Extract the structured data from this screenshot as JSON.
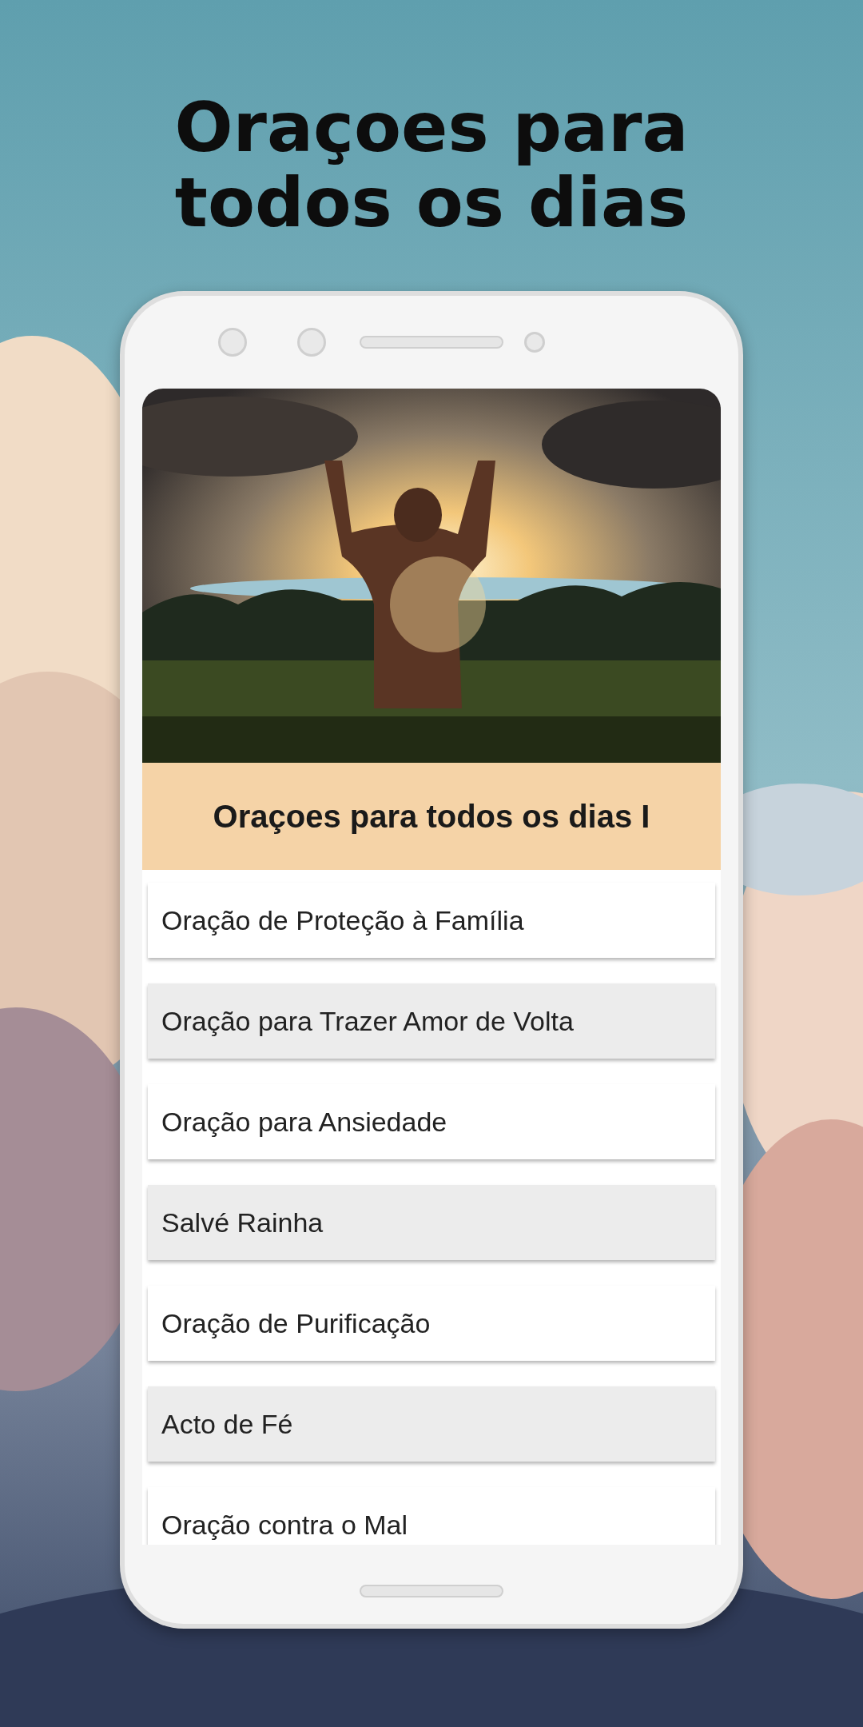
{
  "headline": "Oraçoes para todos os dias",
  "app": {
    "section_title": "Oraçoes para todos os dias I",
    "items": [
      {
        "label": "Oração de Proteção à Família"
      },
      {
        "label": "Oração para Trazer Amor de Volta"
      },
      {
        "label": "Oração para Ansiedade"
      },
      {
        "label": "Salvé Rainha"
      },
      {
        "label": "Oração de Purificação"
      },
      {
        "label": "Acto de Fé"
      },
      {
        "label": "Oração contra o Mal"
      }
    ]
  }
}
